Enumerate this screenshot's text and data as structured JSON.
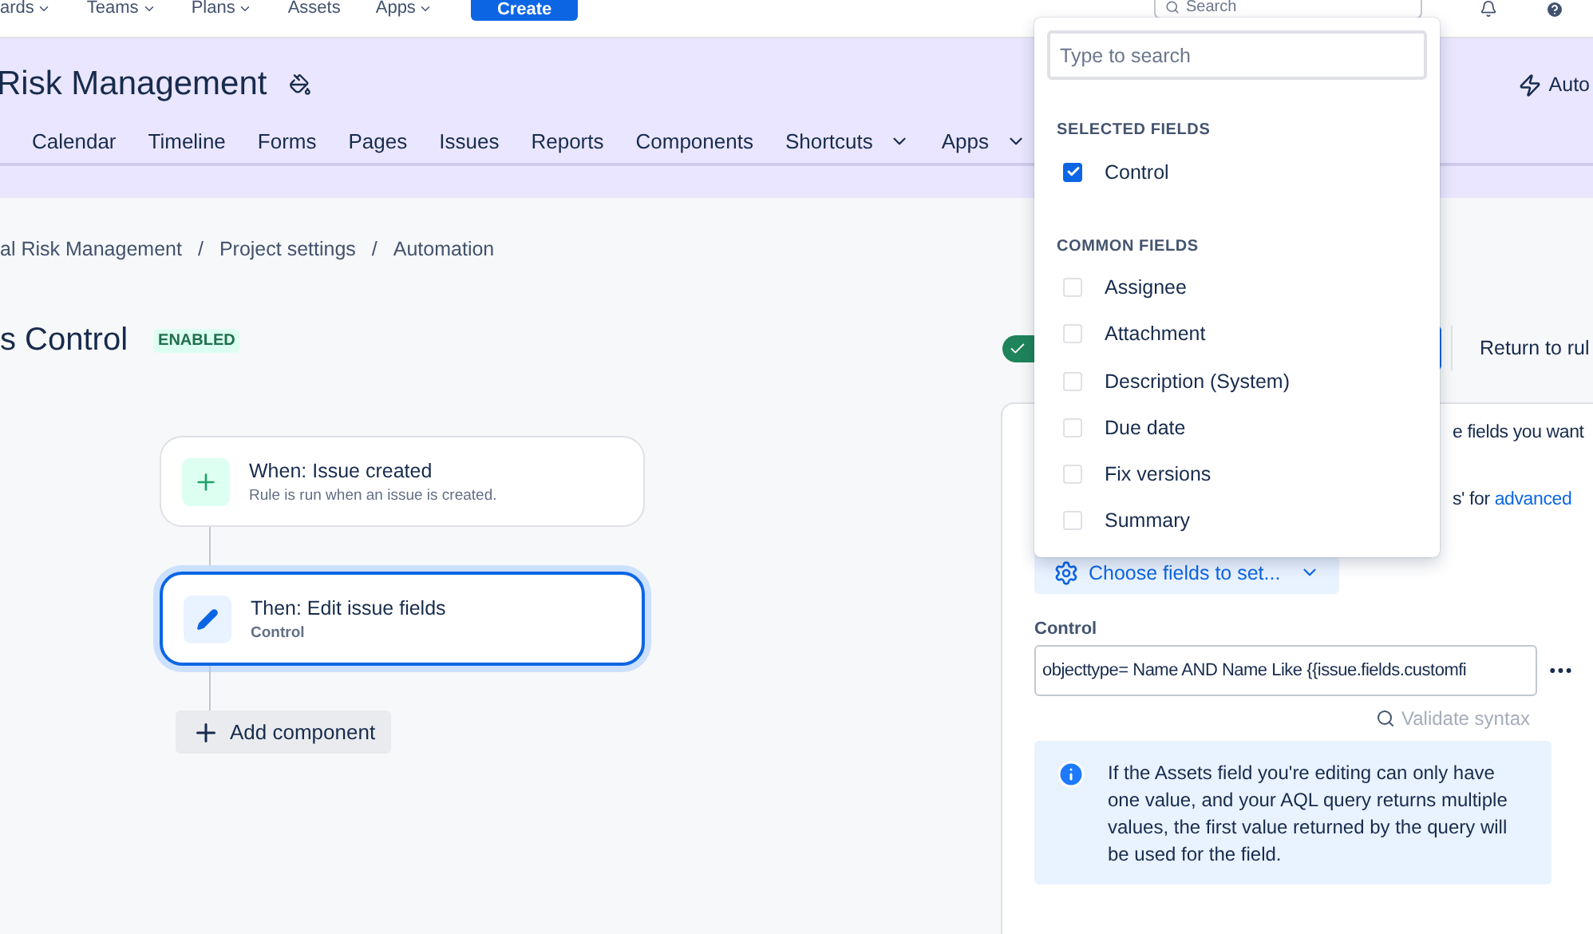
{
  "top_nav": {
    "items": [
      {
        "label": "ards",
        "dropdown": true
      },
      {
        "label": "Teams",
        "dropdown": true
      },
      {
        "label": "Plans",
        "dropdown": true
      },
      {
        "label": "Assets",
        "dropdown": false
      },
      {
        "label": "Apps",
        "dropdown": true
      }
    ],
    "create_button": "Create",
    "search": {
      "placeholder": "Search"
    }
  },
  "project": {
    "title": "Risk Management",
    "automation_link": "Auto",
    "tabs": [
      {
        "label": "Calendar",
        "dropdown": false
      },
      {
        "label": "Timeline",
        "dropdown": false
      },
      {
        "label": "Forms",
        "dropdown": false
      },
      {
        "label": "Pages",
        "dropdown": false
      },
      {
        "label": "Issues",
        "dropdown": false
      },
      {
        "label": "Reports",
        "dropdown": false
      },
      {
        "label": "Components",
        "dropdown": false
      },
      {
        "label": "Shortcuts",
        "dropdown": true
      },
      {
        "label": "Apps",
        "dropdown": true
      }
    ]
  },
  "breadcrumbs": {
    "separator": "/",
    "items": [
      "al Risk Management",
      "Project settings",
      "Automation"
    ]
  },
  "rule": {
    "title": "s Control",
    "status": "ENABLED",
    "enabled": true,
    "return_link": "Return to rul"
  },
  "flow": [
    {
      "kind": "trigger",
      "title": "When: Issue created",
      "subtitle": "Rule is run when an issue is created.",
      "selected": false
    },
    {
      "kind": "action",
      "title": "Then: Edit issue fields",
      "subtitle": "Control",
      "selected": true
    }
  ],
  "add_component": "Add component",
  "panel": {
    "intro_fragment": "e fields you want",
    "link_prefix": "s' for ",
    "link": "advanced",
    "choose_button": "Choose fields to set...",
    "field_label": "Control",
    "field_value": "objecttype= Name AND Name Like {{issue.fields.customfi",
    "validate": "Validate syntax",
    "info": "If the Assets field you're editing can only have one value, and your AQL query returns multiple values, the first value returned by the query will be used for the field."
  },
  "dropdown": {
    "search": {
      "placeholder": "Type to search"
    },
    "groups": [
      {
        "heading": "SELECTED FIELDS",
        "items": [
          {
            "label": "Control",
            "checked": true
          }
        ]
      },
      {
        "heading": "COMMON FIELDS",
        "items": [
          {
            "label": "Assignee",
            "checked": false
          },
          {
            "label": "Attachment",
            "checked": false
          },
          {
            "label": "Description (System)",
            "checked": false
          },
          {
            "label": "Due date",
            "checked": false
          },
          {
            "label": "Fix versions",
            "checked": false
          },
          {
            "label": "Summary",
            "checked": false
          }
        ]
      }
    ]
  }
}
